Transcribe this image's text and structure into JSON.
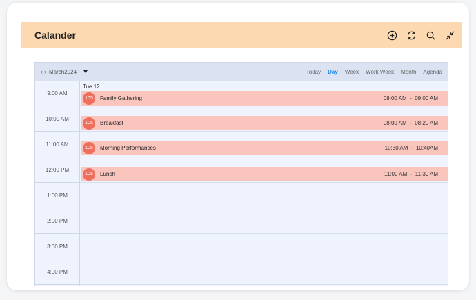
{
  "header": {
    "title": "Calander",
    "icons": [
      "add-icon",
      "refresh-icon",
      "search-icon",
      "collapse-icon"
    ]
  },
  "toolbar": {
    "date_label": "March2024",
    "views": [
      {
        "label": "Today",
        "active": false
      },
      {
        "label": "Day",
        "active": true
      },
      {
        "label": "Week",
        "active": false
      },
      {
        "label": "Work Week",
        "active": false
      },
      {
        "label": "Month",
        "active": false
      },
      {
        "label": "Agenda",
        "active": false
      }
    ]
  },
  "day_header": "Tue 12",
  "time_slots": [
    "9:00 AM",
    "10:00 AM",
    "11:00 AM",
    "12:00 PM",
    "1:00 PM",
    "2:00 PM",
    "3:00 PM",
    "4:00 PM"
  ],
  "events": [
    {
      "badge": "105",
      "title": "Family Gathering",
      "time": "08:00 AM  -  09:00 AM"
    },
    {
      "badge": "105",
      "title": "Breakfast",
      "time": "08:00 AM  -  08:20 AM"
    },
    {
      "badge": "105",
      "title": "Morning Performances",
      "time": "10:30 AM  -  10:40AM"
    },
    {
      "badge": "105",
      "title": "Lunch",
      "time": "11:00 AM  -  11:30 AM"
    }
  ],
  "colors": {
    "header_bg": "#fcd9b1",
    "event_bg": "#f9c5bd",
    "badge_bg": "#ee6f5e",
    "active_view": "#1e88e5"
  }
}
